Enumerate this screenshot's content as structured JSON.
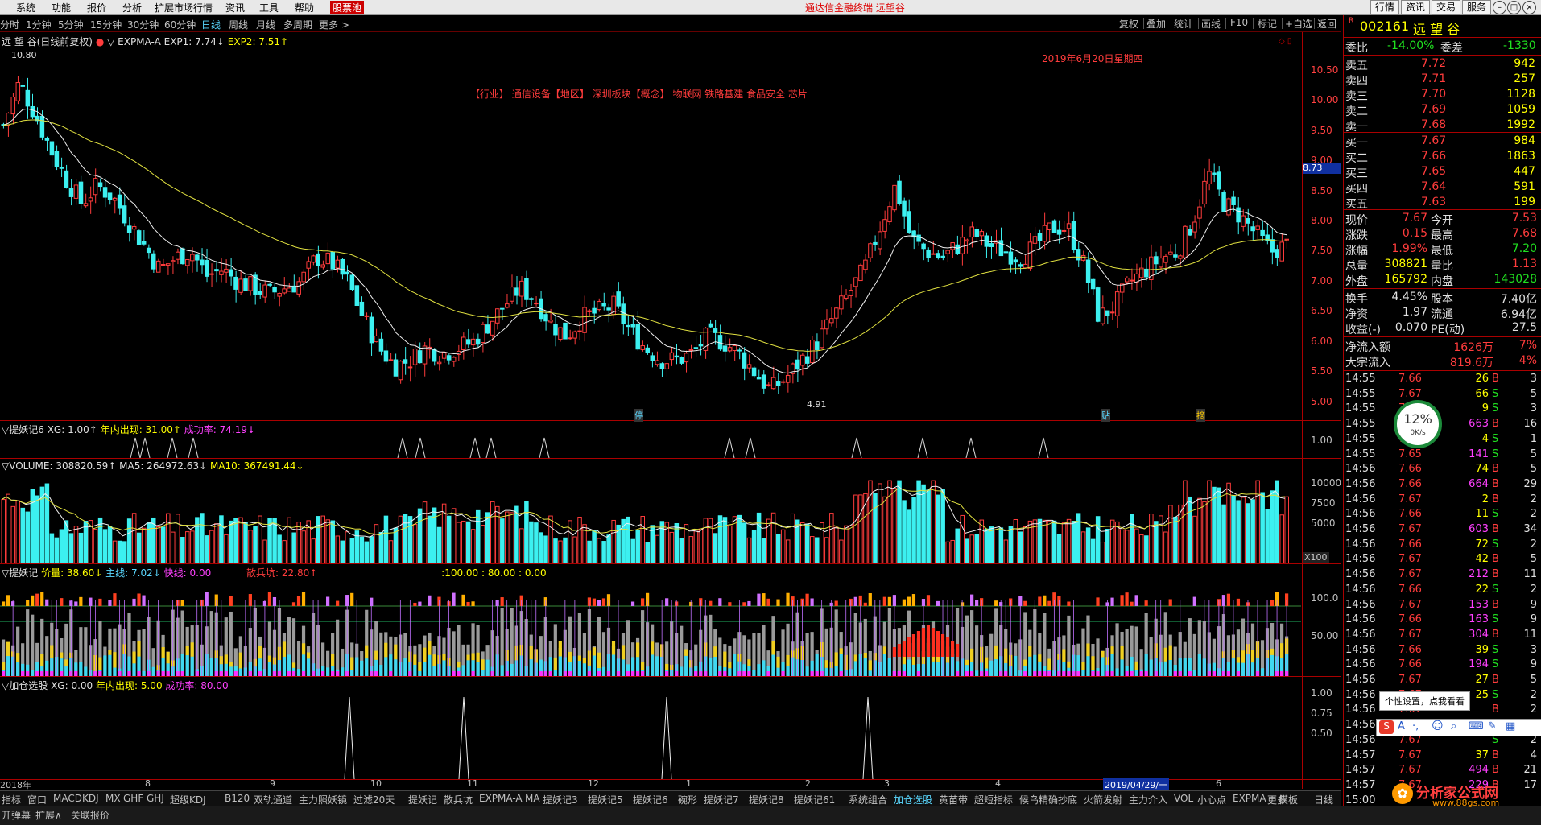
{
  "menu": {
    "items": [
      "系统",
      "功能",
      "报价",
      "分析",
      "扩展市场行情",
      "资讯",
      "工具",
      "帮助"
    ],
    "hot": "股票池",
    "app_title": "通达信金融终端 远望谷",
    "top_buttons": [
      "行情",
      "资讯",
      "交易",
      "服务"
    ]
  },
  "period_bar": {
    "periods": [
      "分时",
      "1分钟",
      "5分钟",
      "15分钟",
      "30分钟",
      "60分钟",
      "日线",
      "周线",
      "月线",
      "多周期",
      "更多 >"
    ],
    "active": "日线",
    "right_tools": [
      "复权",
      "叠加",
      "统计",
      "画线",
      "F10",
      "标记",
      "+自选",
      "返回"
    ]
  },
  "main_chart": {
    "legend": {
      "name": "远 望 谷(日线前复权)",
      "indicator": "▽ EXPMA-A",
      "exp1": "EXP1: 7.74↓",
      "exp2": "EXP2: 7.51↑"
    },
    "date_note": "2019年6月20日星期四",
    "info_tags": "【行业】 通信设备【地区】 深圳板块【概念】 物联网 铁路基建 食品安全 芯片",
    "high_label": "10.80",
    "low_label": "4.91",
    "price_tag": "8.73",
    "y_ticks": [
      "10.50",
      "10.00",
      "9.50",
      "9.00",
      "8.50",
      "8.00",
      "7.50",
      "7.00",
      "6.50",
      "6.00",
      "5.50",
      "5.00"
    ],
    "y_range": [
      4.7,
      10.9
    ],
    "event_marks": [
      "停",
      "贴",
      "摘"
    ],
    "colors": {
      "up": "#ff3c3c",
      "down": "#3cf0f0",
      "exp1": "#f0f0f0",
      "exp2": "#e0e040"
    }
  },
  "chart_data": {
    "type": "candlestick",
    "title": "远 望 谷(日线前复权)",
    "y_axis_ticks": [
      10.5,
      10.0,
      9.5,
      9.0,
      8.5,
      8.0,
      7.5,
      7.0,
      6.5,
      6.0,
      5.5,
      5.0
    ],
    "close_path": [
      9.6,
      10.3,
      9.8,
      9.2,
      8.7,
      8.3,
      8.6,
      8.4,
      8.0,
      7.6,
      7.2,
      7.4,
      7.5,
      7.1,
      7.2,
      7.0,
      6.9,
      6.8,
      6.9,
      7.0,
      7.4,
      7.3,
      7.0,
      6.4,
      5.9,
      5.6,
      5.7,
      5.9,
      5.8,
      5.9,
      6.0,
      6.3,
      6.6,
      6.9,
      6.7,
      6.3,
      6.1,
      6.4,
      6.5,
      6.6,
      6.2,
      5.9,
      5.7,
      5.7,
      5.8,
      6.1,
      6.0,
      5.8,
      5.5,
      5.2,
      5.4,
      5.7,
      6.0,
      6.4,
      6.8,
      7.2,
      7.9,
      8.6,
      7.7,
      7.5,
      7.4,
      7.6,
      7.8,
      7.6,
      7.5,
      7.4,
      7.6,
      7.9,
      7.9,
      7.3,
      6.4,
      6.6,
      7.0,
      7.2,
      7.4,
      7.5,
      8.0,
      8.8,
      8.3,
      8.1,
      7.8,
      7.5,
      7.6
    ],
    "low": 4.91,
    "high": 10.8,
    "exp1": 7.74,
    "exp2": 7.51,
    "volume_ticks": [
      10000,
      7500,
      5000
    ],
    "volume_stats": {
      "volume": 308820.59,
      "ma5": 264972.63,
      "ma10": 367491.44
    },
    "date_labels": [
      "2018年",
      "8",
      "9",
      "10",
      "11",
      "12",
      "1",
      "2",
      "3",
      "4",
      "2019/04/29/一",
      "6"
    ]
  },
  "panels": {
    "p1": {
      "name": "▽提妖记6",
      "xg": "XG: 1.00↑",
      "year": "年内出现: 31.00↑",
      "rate": "成功率: 74.19↓",
      "tick": "1.00"
    },
    "p2": {
      "name": "▽VOLUME: 308820.59↑",
      "ma5": "MA5: 264972.63↓",
      "ma10": "MA10: 367491.44↓",
      "ticks": [
        "10000",
        "7500",
        "5000"
      ],
      "unit": "X100"
    },
    "p3": {
      "name": "▽提妖记",
      "price": "价量: 38.60↓",
      "main": "主线: 7.02↓",
      "fast": "快线: 0.00",
      "scatter": "散兵坑: 22.80↑",
      "extra": ":100.00 : 80.00 : 0.00",
      "ticks": [
        "100.0",
        "50.00"
      ]
    },
    "p4": {
      "name": "▽加仓选股",
      "xg": "XG: 0.00",
      "year": "年内出现: 5.00",
      "rate": "成功率: 80.00",
      "ticks": [
        "1.00",
        "0.75",
        "0.50"
      ]
    }
  },
  "bottom_tabs": [
    "指标",
    "窗口",
    "MACD",
    "KDJ",
    "MX",
    "GHF",
    "GHJ",
    "超级KDJ",
    "B120",
    "双轨通道",
    "主力照妖镜",
    "过滤20天",
    "提妖记",
    "散兵坑",
    "EXPMA-A",
    "MA",
    "提妖记3",
    "提妖记5",
    "提妖记6",
    "碗形",
    "提妖记7",
    "提妖记8",
    "提妖记61",
    "系统组合",
    "加仓选股",
    "黄苗带",
    "超短指标",
    "候鸟精确抄底",
    "火箭发射",
    "主力介入",
    "VOL",
    "小心点",
    "EXPMA",
    "更多"
  ],
  "bottom_active": "加仓选股",
  "bottom_right": [
    "模板",
    "日线"
  ],
  "status": {
    "left": [
      "开弹幕",
      "扩展∧",
      "关联报价"
    ]
  },
  "quote": {
    "code_marker": "R",
    "code": "002161",
    "name": "远 望 谷",
    "weibi_label": "委比",
    "weibi": "-14.00%",
    "weicha_label": "委差",
    "weicha": "-1330",
    "asks": [
      {
        "label": "卖五",
        "price": "7.72",
        "vol": "942"
      },
      {
        "label": "卖四",
        "price": "7.71",
        "vol": "257"
      },
      {
        "label": "卖三",
        "price": "7.70",
        "vol": "1128"
      },
      {
        "label": "卖二",
        "price": "7.69",
        "vol": "1059"
      },
      {
        "label": "卖一",
        "price": "7.68",
        "vol": "1992"
      }
    ],
    "bids": [
      {
        "label": "买一",
        "price": "7.67",
        "vol": "984"
      },
      {
        "label": "买二",
        "price": "7.66",
        "vol": "1863"
      },
      {
        "label": "买三",
        "price": "7.65",
        "vol": "447"
      },
      {
        "label": "买四",
        "price": "7.64",
        "vol": "591"
      },
      {
        "label": "买五",
        "price": "7.63",
        "vol": "199"
      }
    ],
    "stats": [
      {
        "l1": "现价",
        "v1": "7.67",
        "l2": "今开",
        "v2": "7.53"
      },
      {
        "l1": "涨跌",
        "v1": "0.15",
        "l2": "最高",
        "v2": "7.68"
      },
      {
        "l1": "涨幅",
        "v1": "1.99%",
        "l2": "最低",
        "v2": "7.20"
      },
      {
        "l1": "总量",
        "v1": "308821",
        "l2": "量比",
        "v2": "1.13"
      },
      {
        "l1": "外盘",
        "v1": "165792",
        "l2": "内盘",
        "v2": "143028"
      }
    ],
    "stats2": [
      {
        "l1": "换手",
        "v1": "4.45%",
        "l2": "股本",
        "v2": "7.40亿"
      },
      {
        "l1": "净资",
        "v1": "1.97",
        "l2": "流通",
        "v2": "6.94亿"
      },
      {
        "l1": "收益(-)",
        "v1": "0.070",
        "l2": "PE(动)",
        "v2": "27.5"
      }
    ],
    "flow": [
      {
        "label": "净流入额",
        "v": "1626万",
        "p": "7%"
      },
      {
        "label": "大宗流入",
        "v": "819.6万",
        "p": "4%"
      }
    ],
    "ticks": [
      [
        "14:55",
        "7.66",
        "26",
        "B",
        "3"
      ],
      [
        "14:55",
        "7.67",
        "66",
        "S",
        "5"
      ],
      [
        "14:55",
        "7.66",
        "9",
        "S",
        "3"
      ],
      [
        "14:55",
        "7.67",
        "663",
        "B",
        "16"
      ],
      [
        "14:55",
        "7.66",
        "4",
        "S",
        "1"
      ],
      [
        "14:55",
        "7.65",
        "141",
        "S",
        "5"
      ],
      [
        "14:56",
        "7.66",
        "74",
        "B",
        "5"
      ],
      [
        "14:56",
        "7.66",
        "664",
        "B",
        "29"
      ],
      [
        "14:56",
        "7.67",
        "2",
        "B",
        "2"
      ],
      [
        "14:56",
        "7.66",
        "11",
        "S",
        "2"
      ],
      [
        "14:56",
        "7.67",
        "603",
        "B",
        "34"
      ],
      [
        "14:56",
        "7.66",
        "72",
        "S",
        "2"
      ],
      [
        "14:56",
        "7.67",
        "42",
        "B",
        "5"
      ],
      [
        "14:56",
        "7.67",
        "212",
        "B",
        "11"
      ],
      [
        "14:56",
        "7.66",
        "22",
        "S",
        "2"
      ],
      [
        "14:56",
        "7.67",
        "153",
        "B",
        "9"
      ],
      [
        "14:56",
        "7.66",
        "163",
        "S",
        "9"
      ],
      [
        "14:56",
        "7.67",
        "304",
        "B",
        "11"
      ],
      [
        "14:56",
        "7.66",
        "39",
        "S",
        "3"
      ],
      [
        "14:56",
        "7.66",
        "194",
        "S",
        "9"
      ],
      [
        "14:56",
        "7.67",
        "27",
        "B",
        "5"
      ],
      [
        "14:56",
        "7.67",
        "25",
        "S",
        "2"
      ],
      [
        "14:56",
        "7.67",
        "",
        "B",
        "2"
      ],
      [
        "14:56",
        "7.67",
        "",
        "B",
        "2"
      ],
      [
        "14:56",
        "7.67",
        "",
        "S",
        "2"
      ],
      [
        "14:57",
        "7.67",
        "37",
        "B",
        "4"
      ],
      [
        "14:57",
        "7.67",
        "494",
        "B",
        "21"
      ],
      [
        "14:57",
        "7.67",
        "229",
        "B",
        "17"
      ],
      [
        "15:00",
        "",
        "",
        "",
        ""
      ]
    ],
    "gauge": {
      "pct": "12%",
      "rate": "0K/s"
    },
    "tooltip": "个性设置，点我看看",
    "watermark": {
      "name": "分析家公式网",
      "url": "www.88gs.com"
    }
  }
}
